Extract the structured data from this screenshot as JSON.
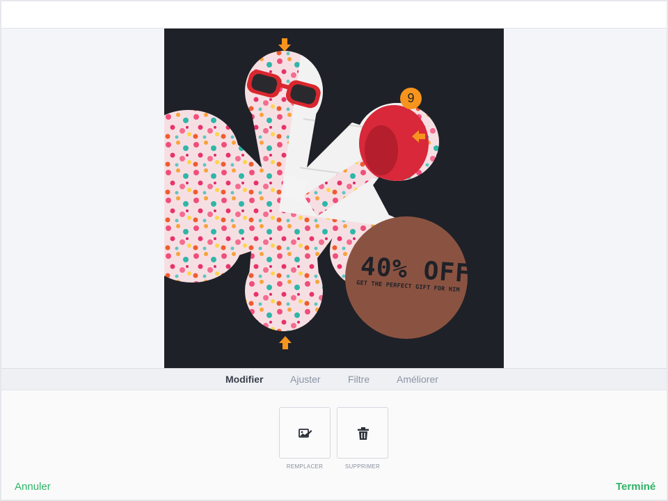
{
  "tabs": [
    {
      "label": "Modifier",
      "active": true
    },
    {
      "label": "Ajuster",
      "active": false
    },
    {
      "label": "Filtre",
      "active": false
    },
    {
      "label": "Améliorer",
      "active": false
    }
  ],
  "tools": [
    {
      "label": "REMPLACER",
      "icon": "image-edit-icon"
    },
    {
      "label": "SUPPRIMER",
      "icon": "trash-icon"
    }
  ],
  "footer": {
    "cancel_label": "Annuler",
    "done_label": "Terminé"
  },
  "design": {
    "promo_headline": "40% OFF",
    "promo_subline": "GET THE PERFECT GIFT FOR HIM",
    "step_badge": "9"
  },
  "colors": {
    "accent_green": "#2fb365",
    "annotation_orange": "#f7941d",
    "canvas_dark": "#1f2128",
    "promo_circle": "#8a5341"
  }
}
